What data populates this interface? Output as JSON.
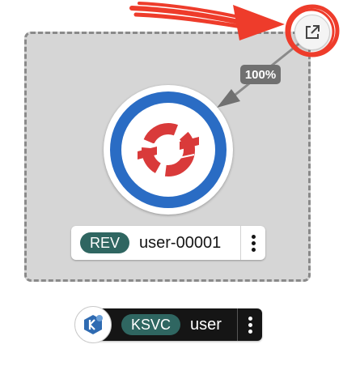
{
  "traffic": {
    "percent_label": "100%"
  },
  "revision": {
    "badge": "REV",
    "name": "user-00001"
  },
  "service": {
    "badge": "KSVC",
    "name": "user"
  },
  "icons": {
    "external_link": "external-link-icon",
    "node_logo": "openshift-logo-icon",
    "knative": "knative-icon",
    "kebab": "kebab-menu-icon"
  },
  "colors": {
    "ring": "#2a6cc4",
    "logo": "#d93a3a",
    "badge": "#2f6661",
    "annotation": "#ee3c2b"
  }
}
